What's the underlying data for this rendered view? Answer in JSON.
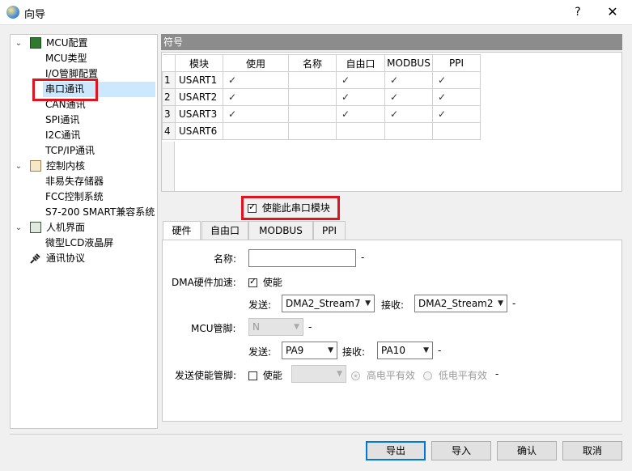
{
  "window": {
    "title": "向导",
    "help_label": "?",
    "close_label": "✕"
  },
  "tree": {
    "groups": [
      {
        "label": "MCU配置",
        "toggle": "⌄",
        "children": [
          "MCU类型",
          "I/O管脚配置",
          "串口通讯",
          "CAN通讯",
          "SPI通讯",
          "I2C通讯",
          "TCP/IP通讯"
        ]
      },
      {
        "label": "控制内核",
        "toggle": "⌄",
        "children": [
          "非易失存储器",
          "FCC控制系统",
          "S7-200 SMART兼容系统"
        ]
      },
      {
        "label": "人机界面",
        "toggle": "⌄",
        "children": [
          "微型LCD液晶屏"
        ]
      },
      {
        "label": "通讯协议",
        "toggle": "",
        "children": []
      }
    ],
    "selected": "串口通讯"
  },
  "symbols": {
    "header": "符号",
    "columns": [
      "模块",
      "使用",
      "名称",
      "自由口",
      "MODBUS",
      "PPI"
    ],
    "rows": [
      {
        "num": "1",
        "module": "USART1",
        "use": "✓",
        "name": "",
        "free": "✓",
        "modbus": "✓",
        "ppi": "✓"
      },
      {
        "num": "2",
        "module": "USART2",
        "use": "✓",
        "name": "",
        "free": "✓",
        "modbus": "✓",
        "ppi": "✓"
      },
      {
        "num": "3",
        "module": "USART3",
        "use": "✓",
        "name": "",
        "free": "✓",
        "modbus": "✓",
        "ppi": "✓"
      },
      {
        "num": "4",
        "module": "USART6",
        "use": "",
        "name": "",
        "free": "",
        "modbus": "",
        "ppi": ""
      }
    ]
  },
  "enable_module": {
    "label": "使能此串口模块",
    "checked": true
  },
  "tabs": [
    "硬件",
    "自由口",
    "MODBUS",
    "PPI"
  ],
  "active_tab": "硬件",
  "hardware": {
    "name_label": "名称:",
    "name_value": "",
    "dash": "-",
    "dma_label": "DMA硬件加速:",
    "dma_enable_label": "使能",
    "send_label": "发送:",
    "recv_label": "接收:",
    "dma_send": "DMA2_Stream7",
    "dma_recv": "DMA2_Stream2",
    "mcu_pin_label": "MCU管脚:",
    "mcu_pin_value": "N",
    "pin_send": "PA9",
    "pin_recv": "PA10",
    "tx_enable_label": "发送使能管脚:",
    "tx_enable_cb_label": "使能",
    "tx_enable_value": "",
    "high_level_label": "高电平有效",
    "low_level_label": "低电平有效"
  },
  "buttons": {
    "prev": "导出",
    "next": "导入",
    "ok": "确认",
    "cancel": "取消"
  },
  "colors": {
    "highlight_red": "#e0141e",
    "selection": "#cce8ff",
    "header_grey": "#8c8c8c"
  }
}
